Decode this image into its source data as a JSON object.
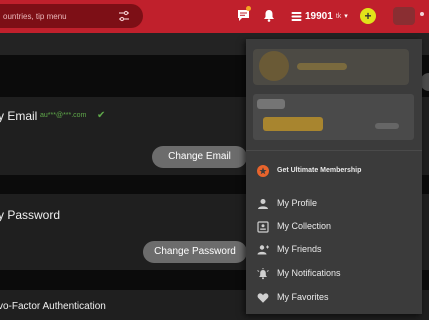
{
  "search": {
    "placeholder": "ountries, tip menu"
  },
  "header": {
    "coins": {
      "amount": "19901",
      "unit": "tk",
      "caret": "▾"
    },
    "add_label": "+"
  },
  "settings": {
    "email": {
      "title": "y Email",
      "masked_value": "au***@***.com",
      "check": "✔",
      "button": "Change Email"
    },
    "password": {
      "title": "y Password",
      "button": "Change Password"
    },
    "two_factor": {
      "title": "vo-Factor Authentication"
    }
  },
  "menu": {
    "membership": "Get Ultimate Membership",
    "items": [
      {
        "label": "My Profile",
        "icon": "user-icon"
      },
      {
        "label": "My Collection",
        "icon": "collection-icon"
      },
      {
        "label": "My Friends",
        "icon": "friends-icon"
      },
      {
        "label": "My Notifications",
        "icon": "notifications-icon"
      },
      {
        "label": "My Favorites",
        "icon": "heart-icon"
      }
    ]
  },
  "colors": {
    "topbar": "#c0202c",
    "accent_yellow": "#e1e31a",
    "membership_orange": "#e8642c",
    "verified_green": "#5fa84a"
  }
}
